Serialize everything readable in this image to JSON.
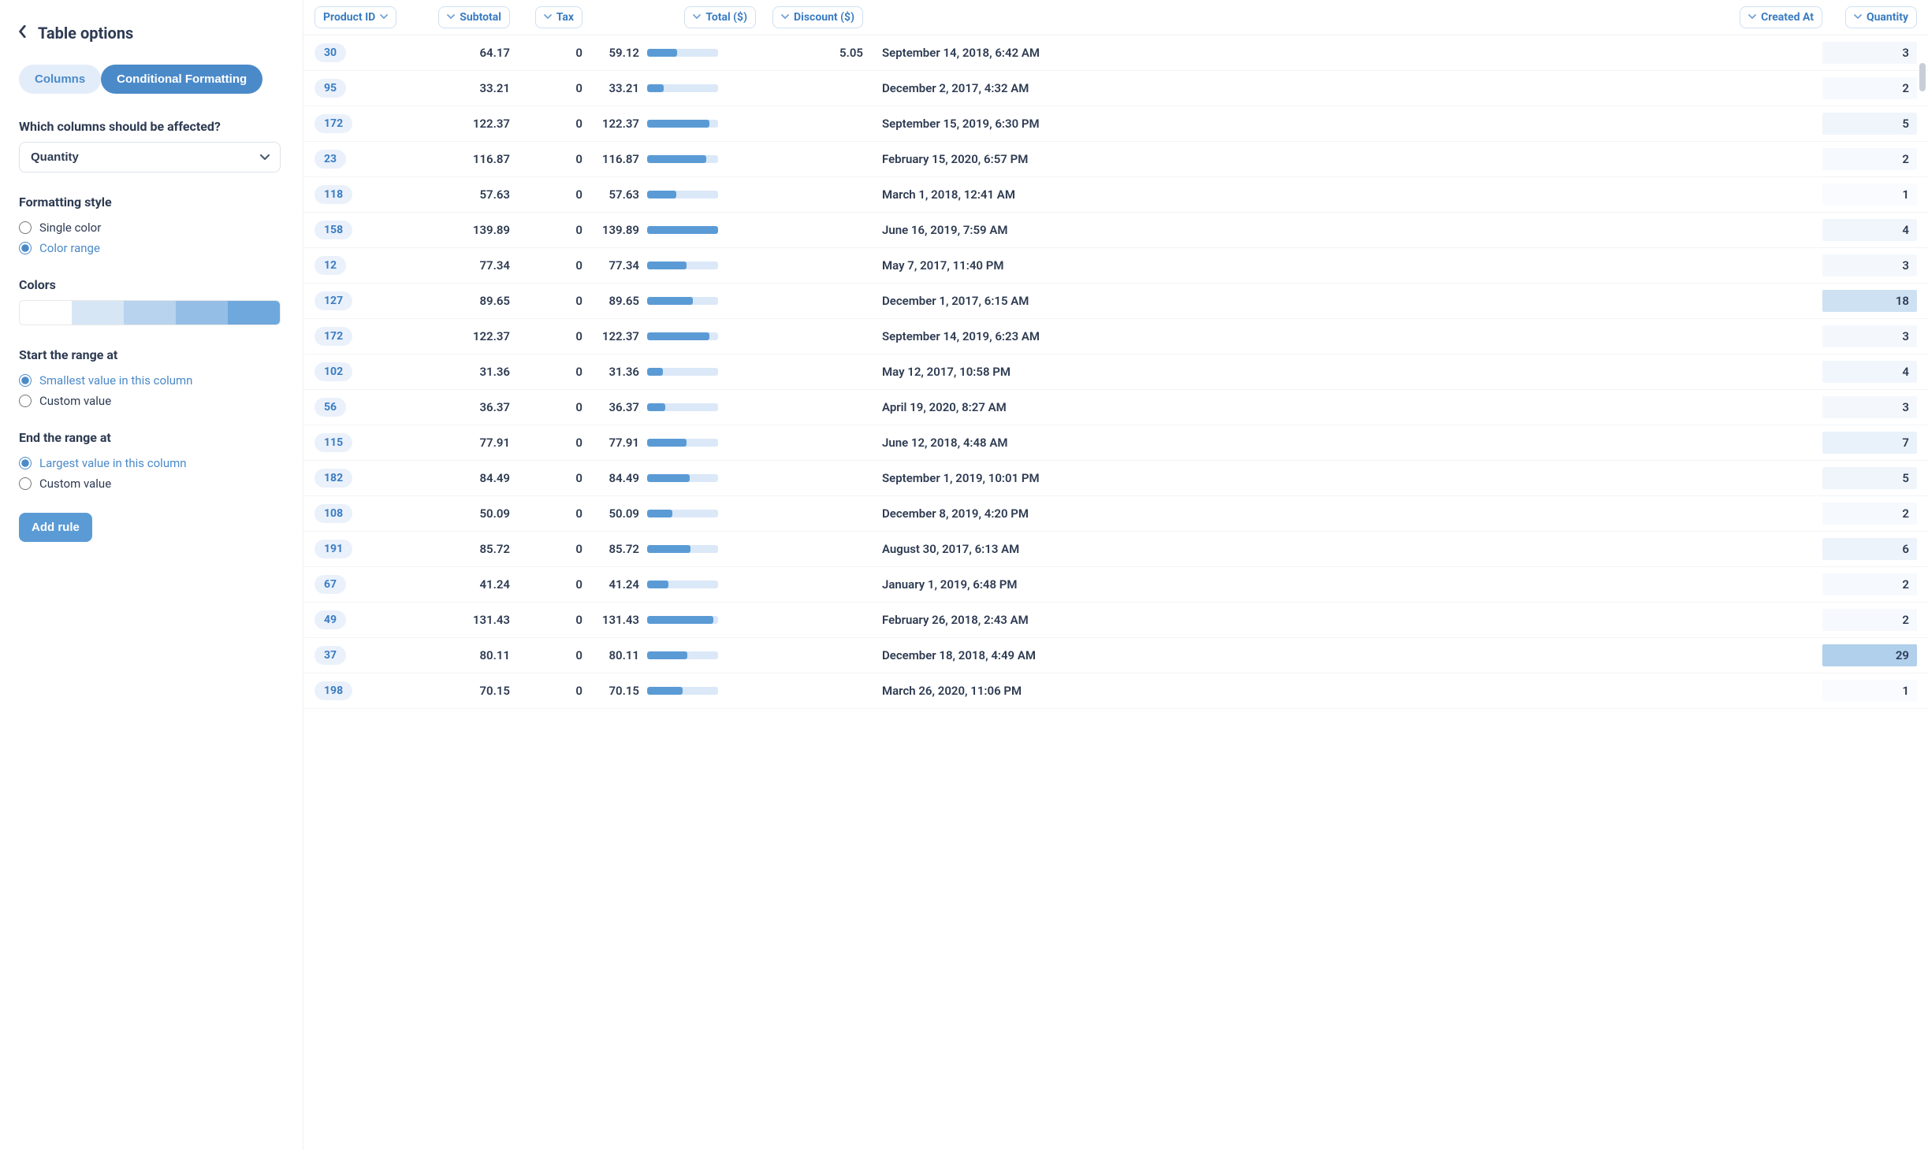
{
  "sidebar": {
    "title": "Table options",
    "tabs": {
      "columns": "Columns",
      "conditional": "Conditional Formatting"
    },
    "affected_label": "Which columns should be affected?",
    "affected_value": "Quantity",
    "style_label": "Formatting style",
    "style_options": {
      "single": "Single color",
      "range": "Color range"
    },
    "style_selected": "range",
    "colors_label": "Colors",
    "ramp": [
      "#ffffff",
      "#d7e6f5",
      "#b8d3ee",
      "#95bee6",
      "#6fa8dc"
    ],
    "start_label": "Start the range at",
    "start_options": {
      "smallest": "Smallest value in this column",
      "custom": "Custom value"
    },
    "start_selected": "smallest",
    "end_label": "End the range at",
    "end_options": {
      "largest": "Largest value in this column",
      "custom": "Custom value"
    },
    "end_selected": "largest",
    "add_rule": "Add rule"
  },
  "table": {
    "columns": [
      {
        "key": "product_id",
        "label": "Product ID"
      },
      {
        "key": "subtotal",
        "label": "Subtotal"
      },
      {
        "key": "tax",
        "label": "Tax"
      },
      {
        "key": "total",
        "label": "Total ($)"
      },
      {
        "key": "discount",
        "label": "Discount ($)"
      },
      {
        "key": "created_at",
        "label": "Created At"
      },
      {
        "key": "quantity",
        "label": "Quantity"
      }
    ],
    "total_max": 140,
    "quantity_min": 1,
    "quantity_max": 29,
    "rows": [
      {
        "product_id": 30,
        "subtotal": "64.17",
        "tax": 0,
        "total": "59.12",
        "discount": "5.05",
        "created_at": "September 14, 2018, 6:42 AM",
        "quantity": 3
      },
      {
        "product_id": 95,
        "subtotal": "33.21",
        "tax": 0,
        "total": "33.21",
        "discount": "",
        "created_at": "December 2, 2017, 4:32 AM",
        "quantity": 2
      },
      {
        "product_id": 172,
        "subtotal": "122.37",
        "tax": 0,
        "total": "122.37",
        "discount": "",
        "created_at": "September 15, 2019, 6:30 PM",
        "quantity": 5
      },
      {
        "product_id": 23,
        "subtotal": "116.87",
        "tax": 0,
        "total": "116.87",
        "discount": "",
        "created_at": "February 15, 2020, 6:57 PM",
        "quantity": 2
      },
      {
        "product_id": 118,
        "subtotal": "57.63",
        "tax": 0,
        "total": "57.63",
        "discount": "",
        "created_at": "March 1, 2018, 12:41 AM",
        "quantity": 1
      },
      {
        "product_id": 158,
        "subtotal": "139.89",
        "tax": 0,
        "total": "139.89",
        "discount": "",
        "created_at": "June 16, 2019, 7:59 AM",
        "quantity": 4
      },
      {
        "product_id": 12,
        "subtotal": "77.34",
        "tax": 0,
        "total": "77.34",
        "discount": "",
        "created_at": "May 7, 2017, 11:40 PM",
        "quantity": 3
      },
      {
        "product_id": 127,
        "subtotal": "89.65",
        "tax": 0,
        "total": "89.65",
        "discount": "",
        "created_at": "December 1, 2017, 6:15 AM",
        "quantity": 18
      },
      {
        "product_id": 172,
        "subtotal": "122.37",
        "tax": 0,
        "total": "122.37",
        "discount": "",
        "created_at": "September 14, 2019, 6:23 AM",
        "quantity": 3
      },
      {
        "product_id": 102,
        "subtotal": "31.36",
        "tax": 0,
        "total": "31.36",
        "discount": "",
        "created_at": "May 12, 2017, 10:58 PM",
        "quantity": 4
      },
      {
        "product_id": 56,
        "subtotal": "36.37",
        "tax": 0,
        "total": "36.37",
        "discount": "",
        "created_at": "April 19, 2020, 8:27 AM",
        "quantity": 3
      },
      {
        "product_id": 115,
        "subtotal": "77.91",
        "tax": 0,
        "total": "77.91",
        "discount": "",
        "created_at": "June 12, 2018, 4:48 AM",
        "quantity": 7
      },
      {
        "product_id": 182,
        "subtotal": "84.49",
        "tax": 0,
        "total": "84.49",
        "discount": "",
        "created_at": "September 1, 2019, 10:01 PM",
        "quantity": 5
      },
      {
        "product_id": 108,
        "subtotal": "50.09",
        "tax": 0,
        "total": "50.09",
        "discount": "",
        "created_at": "December 8, 2019, 4:20 PM",
        "quantity": 2
      },
      {
        "product_id": 191,
        "subtotal": "85.72",
        "tax": 0,
        "total": "85.72",
        "discount": "",
        "created_at": "August 30, 2017, 6:13 AM",
        "quantity": 6
      },
      {
        "product_id": 67,
        "subtotal": "41.24",
        "tax": 0,
        "total": "41.24",
        "discount": "",
        "created_at": "January 1, 2019, 6:48 PM",
        "quantity": 2
      },
      {
        "product_id": 49,
        "subtotal": "131.43",
        "tax": 0,
        "total": "131.43",
        "discount": "",
        "created_at": "February 26, 2018, 2:43 AM",
        "quantity": 2
      },
      {
        "product_id": 37,
        "subtotal": "80.11",
        "tax": 0,
        "total": "80.11",
        "discount": "",
        "created_at": "December 18, 2018, 4:49 AM",
        "quantity": 29
      },
      {
        "product_id": 198,
        "subtotal": "70.15",
        "tax": 0,
        "total": "70.15",
        "discount": "",
        "created_at": "March 26, 2020, 11:06 PM",
        "quantity": 1
      }
    ]
  }
}
